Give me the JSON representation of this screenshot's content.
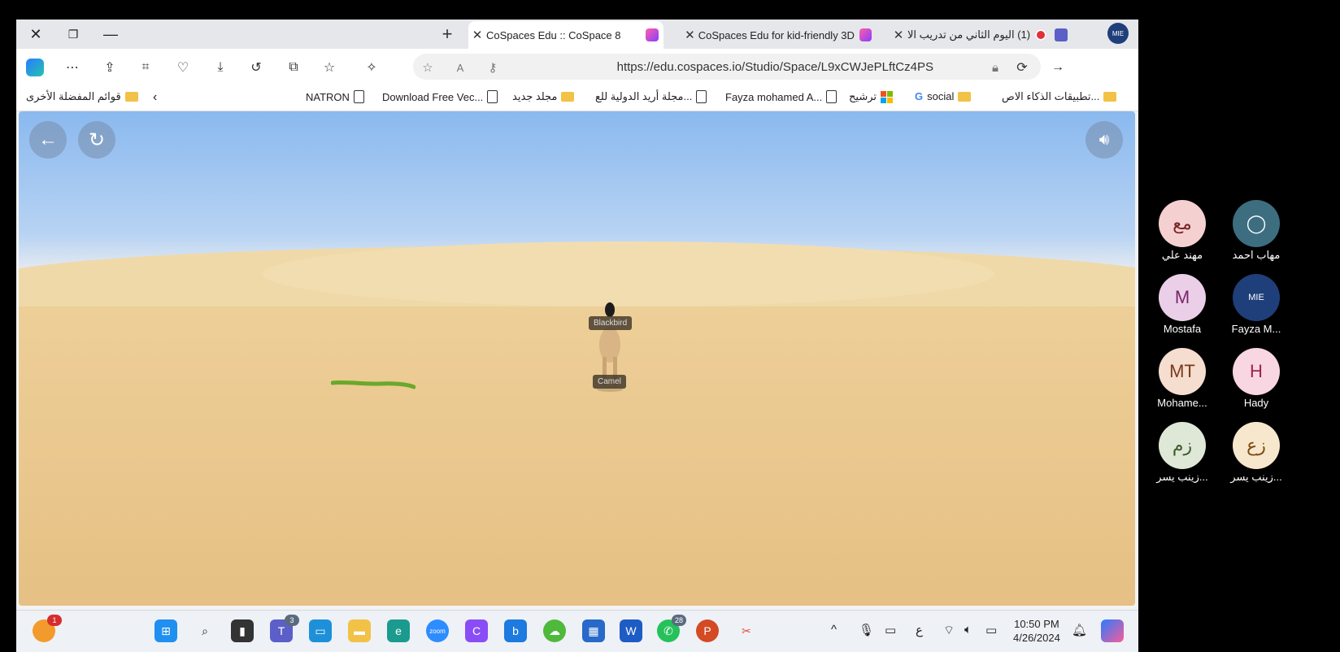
{
  "browser": {
    "tabs": [
      {
        "title": "CoSpaces Edu :: CoSpace 8",
        "active": true
      },
      {
        "title": "CoSpaces Edu for kid-friendly 3D",
        "active": false
      },
      {
        "title": "(1) اليوم الثاني من تدريب الا",
        "active": false
      }
    ],
    "url": "https://edu.cospaces.io/Studio/Space/L9xCWJePLftCz4PS",
    "favorites": [
      {
        "label": "تطبيقات الذكاء الاص...",
        "type": "folder"
      },
      {
        "label": "social",
        "type": "folder"
      },
      {
        "label": "ترشيح",
        "type": "site"
      },
      {
        "label": "Fayza mohamed A...",
        "type": "page"
      },
      {
        "label": "مجلة أريد الدولية للع...",
        "type": "page"
      },
      {
        "label": "مجلد جديد",
        "type": "folder"
      },
      {
        "label": "Download Free Vec...",
        "type": "page"
      },
      {
        "label": "NATRON",
        "type": "page"
      }
    ],
    "other_favorites": "قوائم المفضلة الأخرى",
    "profile_badge": "MIE"
  },
  "scene": {
    "labels": {
      "bird": "Blackbird",
      "camel": "Camel"
    }
  },
  "taskbar": {
    "badges": {
      "app_top_left": "1",
      "teams": "3",
      "whatsapp": "28"
    },
    "time": "10:50 PM",
    "date": "4/26/2024",
    "lang": "ع",
    "zoom_label": "zoom"
  },
  "participants": [
    {
      "initials": "مع",
      "name": "مهند علي",
      "bg": "#f5d0d0",
      "fg": "#7a2323"
    },
    {
      "initials": "",
      "name": "مهاب احمد",
      "bg": "#3c6e80",
      "fg": "#ffffff"
    },
    {
      "initials": "M",
      "name": "Mostafa",
      "bg": "#ebcfe8",
      "fg": "#7a2668"
    },
    {
      "initials": "MIE",
      "name": "Fayza M...",
      "bg": "#1f3f7a",
      "fg": "#ffffff"
    },
    {
      "initials": "MT",
      "name": "Mohame...",
      "bg": "#f5ddd0",
      "fg": "#7a3a18"
    },
    {
      "initials": "H",
      "name": "Hady",
      "bg": "#f8d6e2",
      "fg": "#9a2550"
    },
    {
      "initials": "زم",
      "name": "زينب يسر...",
      "bg": "#dfe8d6",
      "fg": "#3d5a2a"
    },
    {
      "initials": "زع",
      "name": "زينب يسر...",
      "bg": "#f7e7cc",
      "fg": "#7a4a12"
    }
  ]
}
